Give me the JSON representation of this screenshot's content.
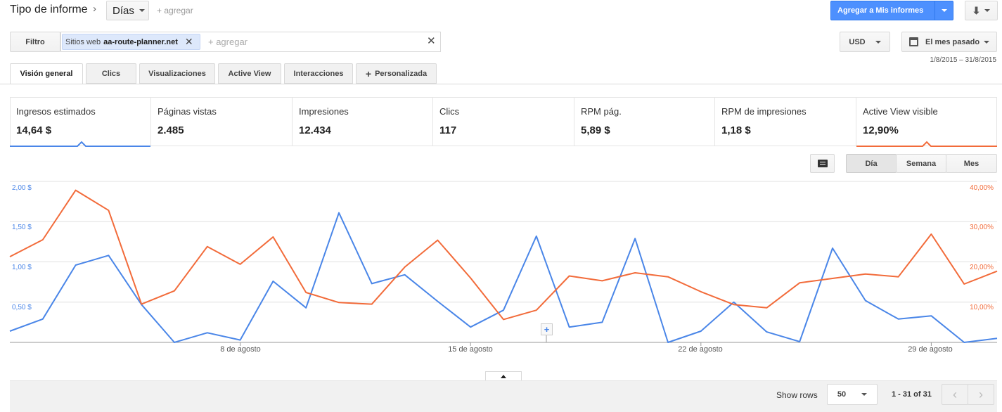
{
  "header": {
    "title": "Tipo de informe",
    "dimension": "Días",
    "add_link": "+ agregar",
    "add_to_reports": "Agregar a Mis informes"
  },
  "filter": {
    "label": "Filtro",
    "chip_prefix": "Sitios web",
    "chip_value": "aa-route-planner.net",
    "add_placeholder": "+ agregar",
    "currency": "USD",
    "date_range_label": "El mes pasado",
    "date_range": "1/8/2015 – 31/8/2015"
  },
  "tabs": [
    {
      "label": "Visión general",
      "active": true
    },
    {
      "label": "Clics"
    },
    {
      "label": "Visualizaciones"
    },
    {
      "label": "Active View"
    },
    {
      "label": "Interacciones"
    },
    {
      "label": "Personalizada"
    }
  ],
  "metrics": [
    {
      "label": "Ingresos estimados",
      "value": "14,64 $",
      "color": "#4a86e8"
    },
    {
      "label": "Páginas vistas",
      "value": "2.485"
    },
    {
      "label": "Impresiones",
      "value": "12.434"
    },
    {
      "label": "Clics",
      "value": "117"
    },
    {
      "label": "RPM pág.",
      "value": "5,89 $"
    },
    {
      "label": "RPM de impresiones",
      "value": "1,18 $"
    },
    {
      "label": "Active View visible",
      "value": "12,90%",
      "color": "#f26b3a"
    }
  ],
  "granularity": {
    "day": "Día",
    "week": "Semana",
    "month": "Mes",
    "selected": "Día"
  },
  "chart_data": {
    "type": "line",
    "x": [
      1,
      2,
      3,
      4,
      5,
      6,
      7,
      8,
      9,
      10,
      11,
      12,
      13,
      14,
      15,
      16,
      17,
      18,
      19,
      20,
      21,
      22,
      23,
      24,
      25,
      26,
      27,
      28,
      29,
      30,
      31
    ],
    "x_unit": "day of August 2015",
    "x_tick_labels": [
      "8 de agosto",
      "15 de agosto",
      "22 de agosto",
      "29 de agosto"
    ],
    "left_axis": {
      "ticks": [
        "2,00 $",
        "1,50 $",
        "1,00 $",
        "0,50 $"
      ],
      "range": [
        0,
        2.0
      ]
    },
    "right_axis": {
      "ticks": [
        "40,00%",
        "30,00%",
        "20,00%",
        "10,00%"
      ],
      "range": [
        0,
        40
      ]
    },
    "series": [
      {
        "name": "Ingresos estimados",
        "axis": "left",
        "color": "#4a86e8",
        "values": [
          0.14,
          0.29,
          0.96,
          1.08,
          0.47,
          0.0,
          0.12,
          0.03,
          0.76,
          0.43,
          1.61,
          0.73,
          0.84,
          0.51,
          0.19,
          0.4,
          1.32,
          0.19,
          0.25,
          1.29,
          0.0,
          0.14,
          0.5,
          0.13,
          0.01,
          1.17,
          0.52,
          0.29,
          0.33,
          0.0,
          0.05
        ]
      },
      {
        "name": "Active View visible",
        "axis": "right",
        "color": "#f26b3a",
        "values": [
          21.3,
          25.5,
          37.8,
          32.8,
          9.5,
          12.8,
          23.8,
          19.4,
          26.2,
          12.4,
          9.9,
          9.5,
          18.7,
          25.4,
          16.0,
          5.7,
          8.0,
          16.5,
          15.3,
          17.3,
          16.3,
          12.6,
          9.4,
          8.6,
          14.8,
          15.9,
          17.0,
          16.3,
          26.9,
          14.5,
          17.7
        ]
      }
    ],
    "grid": true
  },
  "footer": {
    "show_rows_label": "Show rows",
    "rows_value": "50",
    "range_text": "1 - 31 of 31"
  }
}
